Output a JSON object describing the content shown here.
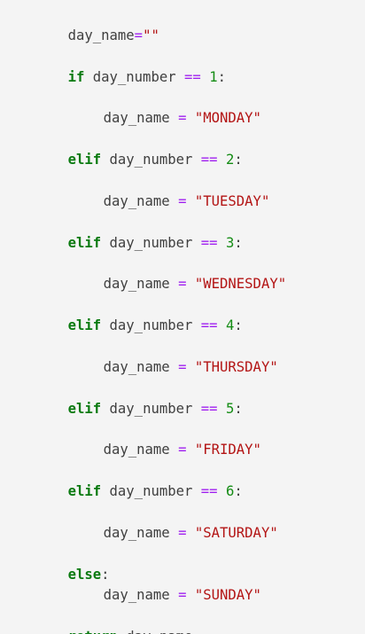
{
  "code": {
    "lines": [
      {
        "parts": [
          {
            "text": "day_name",
            "role": "identifier"
          },
          {
            "text": "=",
            "role": "operator"
          },
          {
            "text": "\"\"",
            "role": "string"
          }
        ]
      },
      {
        "parts": [
          {
            "text": "if",
            "role": "keyword"
          },
          {
            "text": " day_number ",
            "role": "identifier"
          },
          {
            "text": "==",
            "role": "operator"
          },
          {
            "text": " ",
            "role": "identifier"
          },
          {
            "text": "1",
            "role": "number"
          },
          {
            "text": ":",
            "role": "punctuation"
          }
        ]
      },
      {
        "parts": [
          {
            "text": "day_name ",
            "role": "identifier"
          },
          {
            "text": "=",
            "role": "operator"
          },
          {
            "text": " ",
            "role": "identifier"
          },
          {
            "text": "\"MONDAY\"",
            "role": "string"
          }
        ]
      },
      {
        "parts": [
          {
            "text": "elif",
            "role": "keyword"
          },
          {
            "text": " day_number ",
            "role": "identifier"
          },
          {
            "text": "==",
            "role": "operator"
          },
          {
            "text": " ",
            "role": "identifier"
          },
          {
            "text": "2",
            "role": "number"
          },
          {
            "text": ":",
            "role": "punctuation"
          }
        ]
      },
      {
        "parts": [
          {
            "text": "day_name ",
            "role": "identifier"
          },
          {
            "text": "=",
            "role": "operator"
          },
          {
            "text": " ",
            "role": "identifier"
          },
          {
            "text": "\"TUESDAY\"",
            "role": "string"
          }
        ]
      },
      {
        "parts": [
          {
            "text": "elif",
            "role": "keyword"
          },
          {
            "text": " day_number ",
            "role": "identifier"
          },
          {
            "text": "==",
            "role": "operator"
          },
          {
            "text": " ",
            "role": "identifier"
          },
          {
            "text": "3",
            "role": "number"
          },
          {
            "text": ":",
            "role": "punctuation"
          }
        ]
      },
      {
        "parts": [
          {
            "text": "day_name ",
            "role": "identifier"
          },
          {
            "text": "=",
            "role": "operator"
          },
          {
            "text": " ",
            "role": "identifier"
          },
          {
            "text": "\"WEDNESDAY\"",
            "role": "string"
          }
        ]
      },
      {
        "parts": [
          {
            "text": "elif",
            "role": "keyword"
          },
          {
            "text": " day_number ",
            "role": "identifier"
          },
          {
            "text": "==",
            "role": "operator"
          },
          {
            "text": " ",
            "role": "identifier"
          },
          {
            "text": "4",
            "role": "number"
          },
          {
            "text": ":",
            "role": "punctuation"
          }
        ]
      },
      {
        "parts": [
          {
            "text": "day_name ",
            "role": "identifier"
          },
          {
            "text": "=",
            "role": "operator"
          },
          {
            "text": " ",
            "role": "identifier"
          },
          {
            "text": "\"THURSDAY\"",
            "role": "string"
          }
        ]
      },
      {
        "parts": [
          {
            "text": "elif",
            "role": "keyword"
          },
          {
            "text": " day_number ",
            "role": "identifier"
          },
          {
            "text": "==",
            "role": "operator"
          },
          {
            "text": " ",
            "role": "identifier"
          },
          {
            "text": "5",
            "role": "number"
          },
          {
            "text": ":",
            "role": "punctuation"
          }
        ]
      },
      {
        "parts": [
          {
            "text": "day_name ",
            "role": "identifier"
          },
          {
            "text": "=",
            "role": "operator"
          },
          {
            "text": " ",
            "role": "identifier"
          },
          {
            "text": "\"FRIDAY\"",
            "role": "string"
          }
        ]
      },
      {
        "parts": [
          {
            "text": "elif",
            "role": "keyword"
          },
          {
            "text": " day_number ",
            "role": "identifier"
          },
          {
            "text": "==",
            "role": "operator"
          },
          {
            "text": " ",
            "role": "identifier"
          },
          {
            "text": "6",
            "role": "number"
          },
          {
            "text": ":",
            "role": "punctuation"
          }
        ]
      },
      {
        "parts": [
          {
            "text": "day_name ",
            "role": "identifier"
          },
          {
            "text": "=",
            "role": "operator"
          },
          {
            "text": " ",
            "role": "identifier"
          },
          {
            "text": "\"SATURDAY\"",
            "role": "string"
          }
        ]
      },
      {
        "parts": [
          {
            "text": "else",
            "role": "keyword"
          },
          {
            "text": ":",
            "role": "punctuation"
          }
        ]
      },
      {
        "parts": [
          {
            "text": "day_name ",
            "role": "identifier"
          },
          {
            "text": "=",
            "role": "operator"
          },
          {
            "text": " ",
            "role": "identifier"
          },
          {
            "text": "\"SUNDAY\"",
            "role": "string"
          }
        ]
      },
      {
        "parts": [
          {
            "text": "return",
            "role": "keyword"
          },
          {
            "text": " day_name",
            "role": "identifier"
          }
        ]
      }
    ]
  },
  "colors": {
    "background": "#f4f4f4",
    "keyword": "#0a7a10",
    "operator": "#a020f0",
    "number": "#148c14",
    "string": "#b31414",
    "text": "#3f3f3f"
  }
}
